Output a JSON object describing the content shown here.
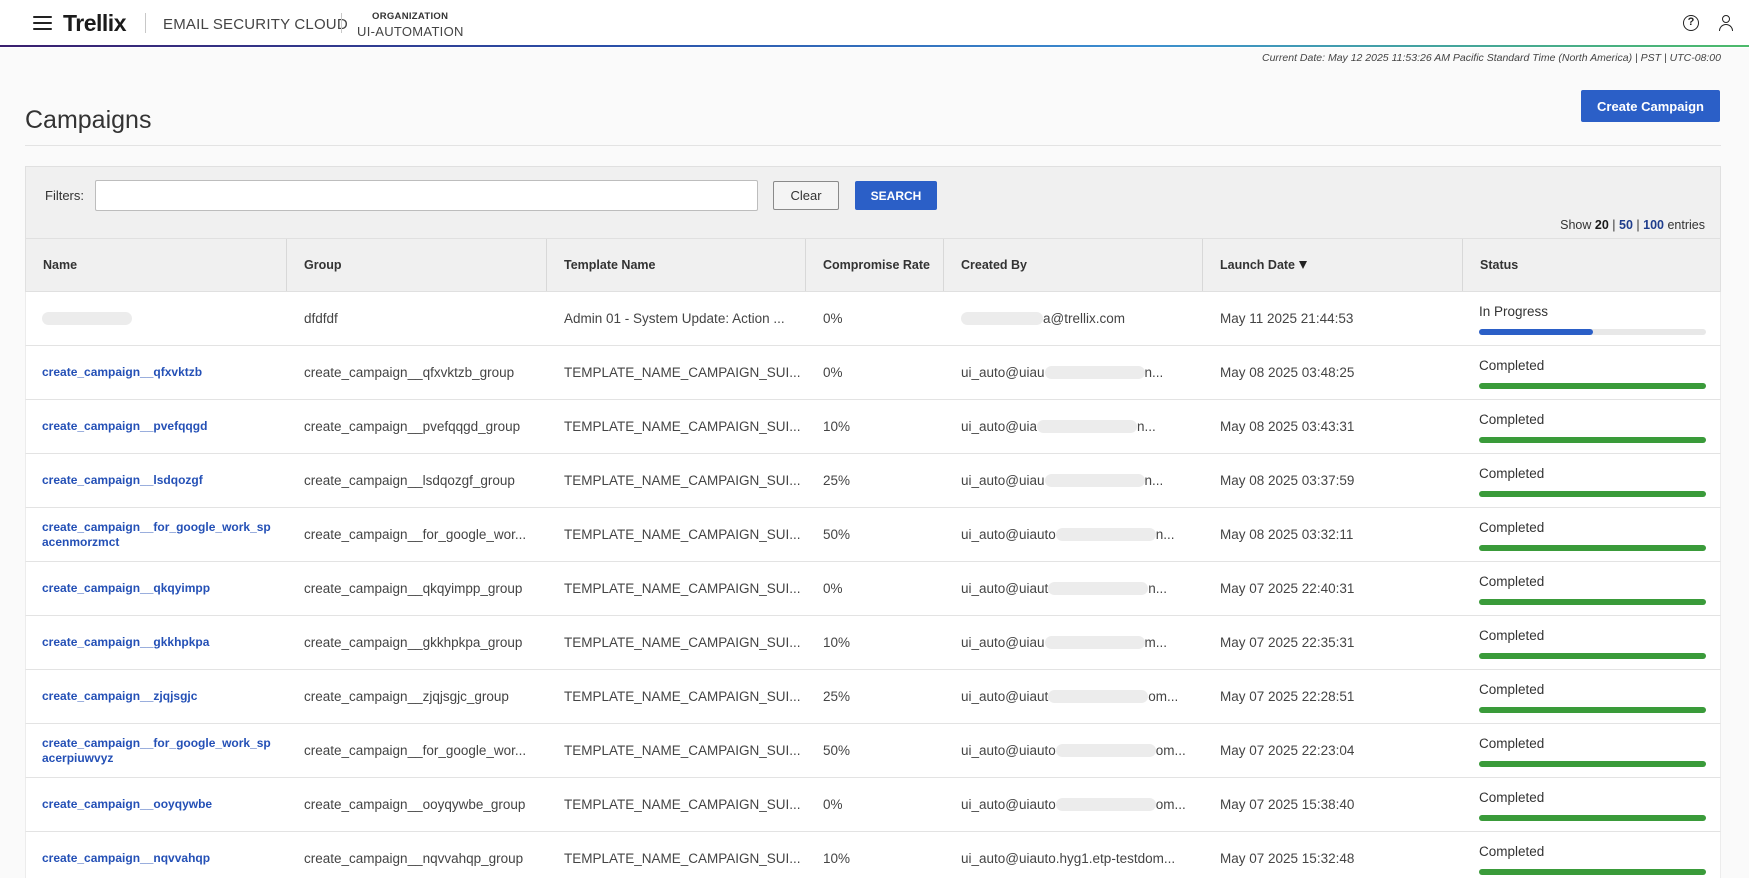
{
  "header": {
    "brand": "Trellix",
    "product": "EMAIL SECURITY CLOUD",
    "org_label": "ORGANIZATION",
    "org_value": "UI-AUTOMATION",
    "current_date": "Current Date: May 12 2025 11:53:26 AM Pacific Standard Time (North America) | PST | UTC-08:00"
  },
  "page": {
    "title": "Campaigns",
    "create_button": "Create Campaign"
  },
  "filters": {
    "label": "Filters:",
    "value": "",
    "clear_button": "Clear",
    "search_button": "SEARCH",
    "show_label": "Show",
    "entries_label": "entries",
    "page_sizes": [
      "20",
      "50",
      "100"
    ],
    "selected_page_size": "20"
  },
  "table": {
    "columns": [
      "Name",
      "Group",
      "Template Name",
      "Compromise Rate",
      "Created By",
      "Launch Date",
      "Status"
    ],
    "sort_column": "Launch Date",
    "rows": [
      {
        "name": "",
        "group": "dfdfdf",
        "template": "Admin 01 - System Update: Action ...",
        "rate": "0%",
        "created_pre": "",
        "created_post": "a@trellix.com",
        "launch": "May 11 2025 21:44:53",
        "status": "In Progress",
        "progress": 0.5
      },
      {
        "name": "create_campaign__qfxvktzb",
        "group": "create_campaign__qfxvktzb_group",
        "template": "TEMPLATE_NAME_CAMPAIGN_SUI...",
        "rate": "0%",
        "created_pre": "ui_auto@uiau",
        "created_post": "n...",
        "launch": "May 08 2025 03:48:25",
        "status": "Completed",
        "progress": 1.0
      },
      {
        "name": "create_campaign__pvefqqgd",
        "group": "create_campaign__pvefqqgd_group",
        "template": "TEMPLATE_NAME_CAMPAIGN_SUI...",
        "rate": "10%",
        "created_pre": "ui_auto@uia",
        "created_post": "n...",
        "launch": "May 08 2025 03:43:31",
        "status": "Completed",
        "progress": 1.0
      },
      {
        "name": "create_campaign__lsdqozgf",
        "group": "create_campaign__lsdqozgf_group",
        "template": "TEMPLATE_NAME_CAMPAIGN_SUI...",
        "rate": "25%",
        "created_pre": "ui_auto@uiau",
        "created_post": "n...",
        "launch": "May 08 2025 03:37:59",
        "status": "Completed",
        "progress": 1.0
      },
      {
        "name": "create_campaign__for_google_work_spacenmorzmct",
        "group": "create_campaign__for_google_wor...",
        "template": "TEMPLATE_NAME_CAMPAIGN_SUI...",
        "rate": "50%",
        "created_pre": "ui_auto@uiauto",
        "created_post": "n...",
        "launch": "May 08 2025 03:32:11",
        "status": "Completed",
        "progress": 1.0
      },
      {
        "name": "create_campaign__qkqyimpp",
        "group": "create_campaign__qkqyimpp_group",
        "template": "TEMPLATE_NAME_CAMPAIGN_SUI...",
        "rate": "0%",
        "created_pre": "ui_auto@uiaut",
        "created_post": "n...",
        "launch": "May 07 2025 22:40:31",
        "status": "Completed",
        "progress": 1.0
      },
      {
        "name": "create_campaign__gkkhpkpa",
        "group": "create_campaign__gkkhpkpa_group",
        "template": "TEMPLATE_NAME_CAMPAIGN_SUI...",
        "rate": "10%",
        "created_pre": "ui_auto@uiau",
        "created_post": "m...",
        "launch": "May 07 2025 22:35:31",
        "status": "Completed",
        "progress": 1.0
      },
      {
        "name": "create_campaign__zjqjsgjc",
        "group": "create_campaign__zjqjsgjc_group",
        "template": "TEMPLATE_NAME_CAMPAIGN_SUI...",
        "rate": "25%",
        "created_pre": "ui_auto@uiaut",
        "created_post": "om...",
        "launch": "May 07 2025 22:28:51",
        "status": "Completed",
        "progress": 1.0
      },
      {
        "name": "create_campaign__for_google_work_spacerpiuwvyz",
        "group": "create_campaign__for_google_wor...",
        "template": "TEMPLATE_NAME_CAMPAIGN_SUI...",
        "rate": "50%",
        "created_pre": "ui_auto@uiauto",
        "created_post": "om...",
        "launch": "May 07 2025 22:23:04",
        "status": "Completed",
        "progress": 1.0
      },
      {
        "name": "create_campaign__ooyqywbe",
        "group": "create_campaign__ooyqywbe_group",
        "template": "TEMPLATE_NAME_CAMPAIGN_SUI...",
        "rate": "0%",
        "created_pre": "ui_auto@uiauto",
        "created_post": "om...",
        "launch": "May 07 2025 15:38:40",
        "status": "Completed",
        "progress": 1.0
      },
      {
        "name": "create_campaign__nqvvahqp",
        "group": "create_campaign__nqvvahqp_group",
        "template": "TEMPLATE_NAME_CAMPAIGN_SUI...",
        "rate": "10%",
        "created_pre": "ui_auto@uiauto.hyg1.etp-testdom...",
        "created_post": "",
        "launch": "May 07 2025 15:32:48",
        "status": "Completed",
        "progress": 1.0
      }
    ]
  },
  "colors": {
    "accent": "#2b5fc7",
    "link": "#2450b6",
    "progress_in_progress": "#2b5fc7",
    "progress_completed": "#3a9b3a"
  },
  "icons": {
    "menu": "hamburger-menu-icon",
    "help": "help-circle-icon",
    "user": "user-icon",
    "sort": "sort-desc-icon"
  }
}
